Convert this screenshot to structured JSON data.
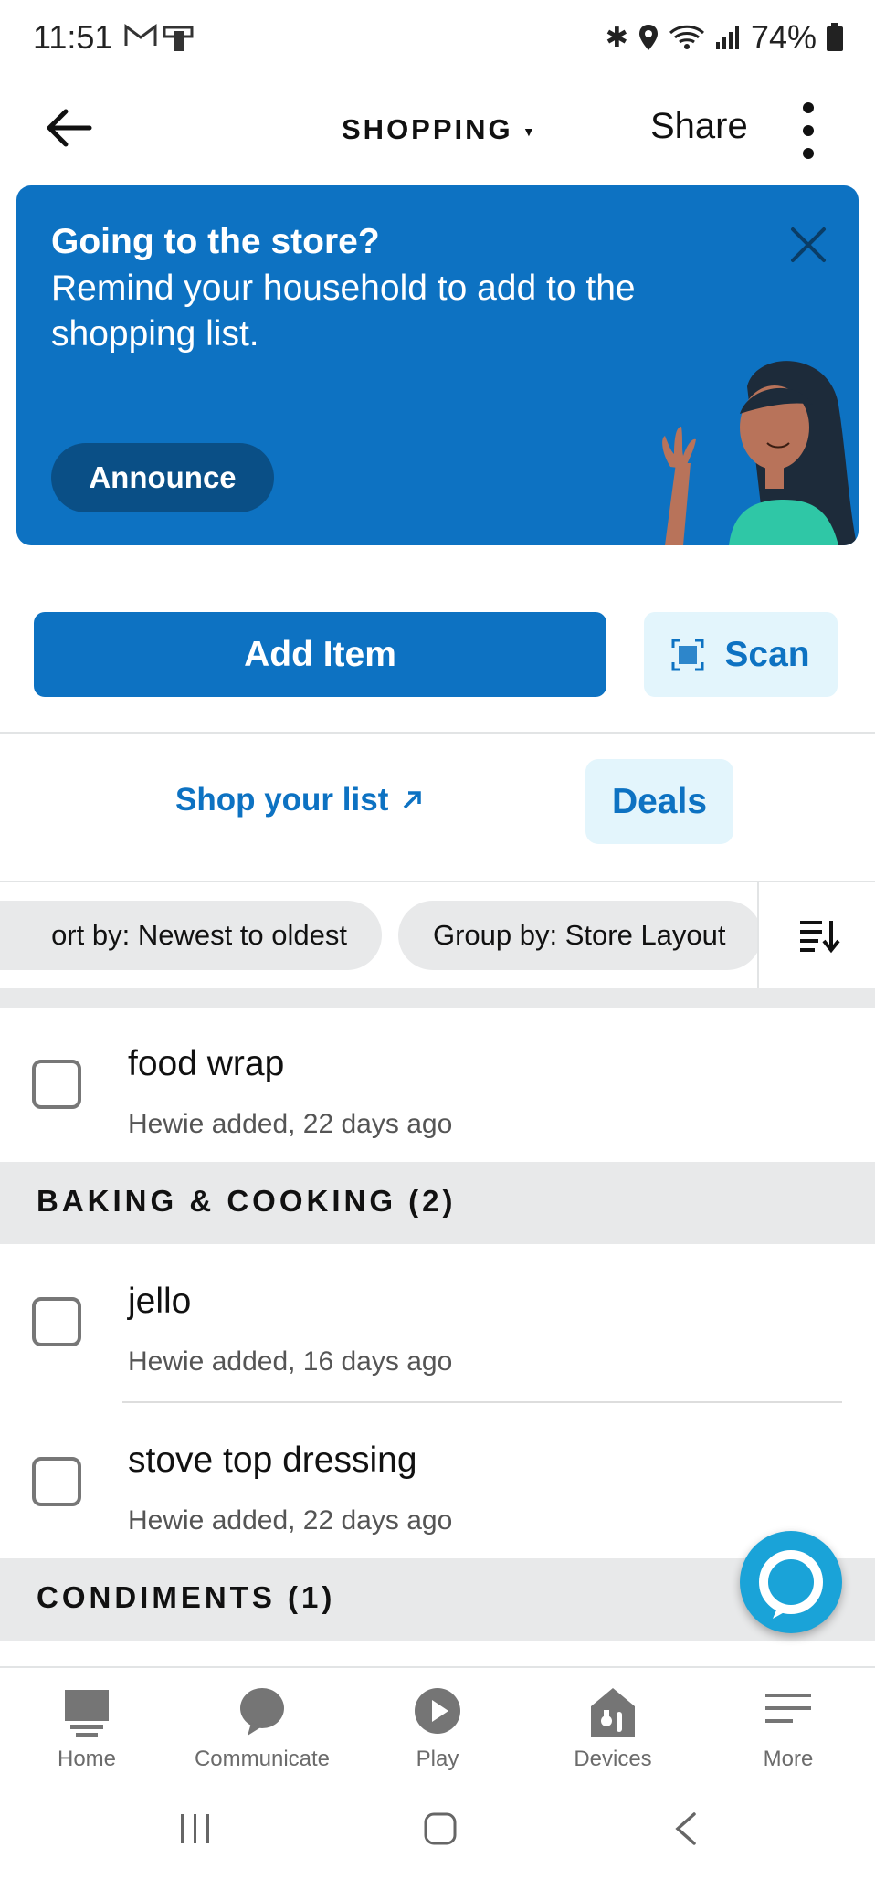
{
  "status_bar": {
    "time": "11:51",
    "battery": "74%"
  },
  "header": {
    "title": "SHOPPING",
    "share_label": "Share"
  },
  "banner": {
    "heading": "Going to the store?",
    "body": "Remind your household to add to the shopping list.",
    "button_label": "Announce"
  },
  "actions": {
    "add_item_label": "Add Item",
    "scan_label": "Scan"
  },
  "links": {
    "shop_list_label": "Shop your list",
    "deals_label": "Deals"
  },
  "filters": {
    "sort_label": "ort by: Newest to oldest",
    "group_label": "Group by: Store Layout"
  },
  "items_top": [
    {
      "name": "food wrap",
      "meta": "Hewie added, 22 days ago"
    }
  ],
  "sections": [
    {
      "title": "BAKING & COOKING (2)",
      "items": [
        {
          "name": "jello",
          "meta": "Hewie added, 16 days ago"
        },
        {
          "name": "stove top dressing",
          "meta": "Hewie added, 22 days ago"
        }
      ]
    },
    {
      "title": "CONDIMENTS (1)",
      "items": []
    }
  ],
  "bottom_nav": [
    {
      "label": "Home",
      "icon": "home-icon"
    },
    {
      "label": "Communicate",
      "icon": "chat-bubble-icon"
    },
    {
      "label": "Play",
      "icon": "play-icon"
    },
    {
      "label": "Devices",
      "icon": "devices-icon"
    },
    {
      "label": "More",
      "icon": "menu-icon"
    }
  ],
  "colors": {
    "accent": "#0d72c2",
    "light_accent": "#e3f5fc",
    "alexa": "#1aa3d8"
  }
}
